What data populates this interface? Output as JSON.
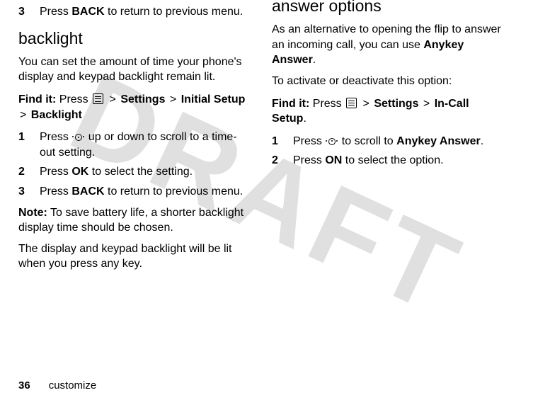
{
  "watermark": "DRAFT",
  "left": {
    "step3_num": "3",
    "step3_text_a": "Press ",
    "step3_back": "BACK",
    "step3_text_b": " to return to previous menu.",
    "h_backlight": "backlight",
    "backlight_intro": "You can set the amount of time your phone's display and keypad backlight remain lit.",
    "findit_label": "Find it: ",
    "findit_a": "Press ",
    "findit_settings": "Settings",
    "findit_init": "Initial Setup",
    "findit_backlight": "Backlight",
    "bl1_num": "1",
    "bl1_a": "Press ",
    "bl1_b": " up or down to scroll to a time-out setting.",
    "bl2_num": "2",
    "bl2_a": "Press ",
    "bl2_ok": "OK",
    "bl2_b": " to select the setting.",
    "bl3_num": "3",
    "bl3_a": "Press ",
    "bl3_back": "BACK",
    "bl3_b": " to return to previous menu.",
    "note_label": "Note:",
    "note_text": " To save battery life, a shorter backlight display time should be chosen.",
    "note2": "The display and keypad backlight will be lit when you press any key."
  },
  "right": {
    "heading": "answer options",
    "intro_a": "As an alternative to opening the flip to answer an incoming call, you can use ",
    "intro_anykey": "Anykey Answer",
    "intro_b": ".",
    "activate": "To activate or deactivate this option:",
    "findit_label": "Find it: ",
    "findit_a": "Press ",
    "findit_settings": "Settings",
    "findit_incall": "In-Call Setup",
    "findit_end": ".",
    "s1_num": "1",
    "s1_a": "Press ",
    "s1_b": " to scroll to ",
    "s1_anykey": "Anykey Answer",
    "s1_c": ".",
    "s2_num": "2",
    "s2_a": "Press ",
    "s2_on": "ON",
    "s2_b": " to select the option."
  },
  "footer": {
    "page": "36",
    "section": "customize"
  }
}
